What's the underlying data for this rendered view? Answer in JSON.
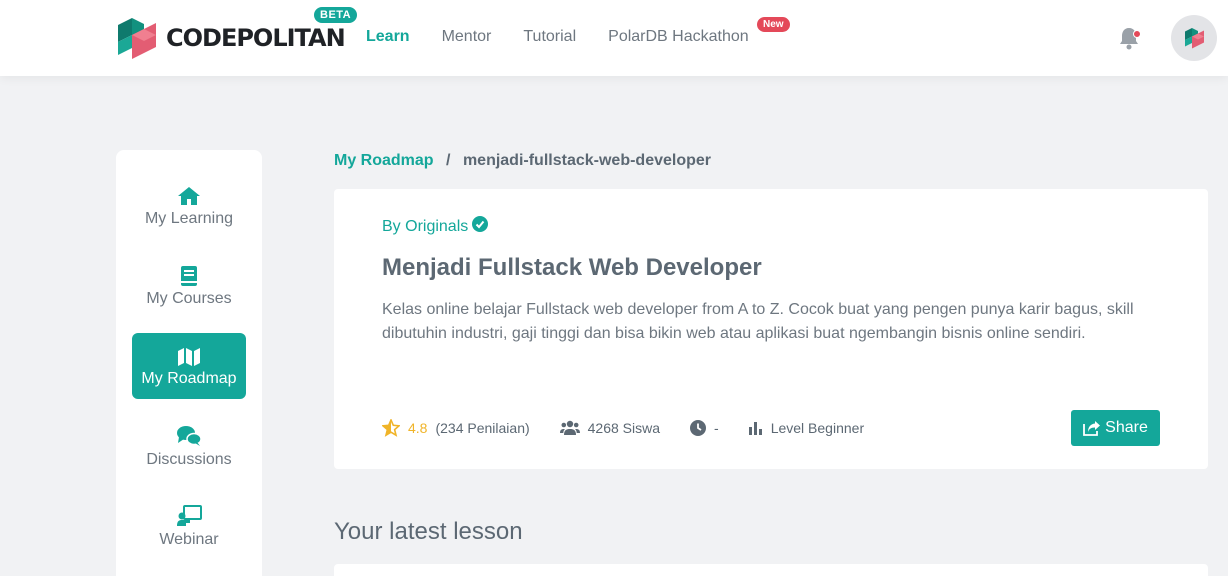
{
  "header": {
    "logo_text": "CODEPOLITAN",
    "beta_badge": "BETA",
    "nav": [
      "Learn",
      "Mentor",
      "Tutorial",
      "PolarDB Hackathon"
    ],
    "new_badge": "New"
  },
  "sidebar": {
    "items": [
      {
        "label": "My Learning",
        "icon": "home-icon"
      },
      {
        "label": "My Courses",
        "icon": "book-icon"
      },
      {
        "label": "My Roadmap",
        "icon": "map-icon"
      },
      {
        "label": "Discussions",
        "icon": "comments-icon"
      },
      {
        "label": "Webinar",
        "icon": "presentation-icon"
      }
    ],
    "active": "My Roadmap"
  },
  "breadcrumb": {
    "link": "My Roadmap",
    "separator": "/",
    "current": "menjadi-fullstack-web-developer"
  },
  "course": {
    "by": "By Originals",
    "title": "Menjadi Fullstack Web Developer",
    "description": "Kelas online belajar Fullstack web developer from A to Z. Cocok buat yang pengen punya karir bagus, skill dibutuhin industri, gaji tinggi dan bisa bikin web atau aplikasi buat ngembangin bisnis online sendiri.",
    "rating": "4.8",
    "reviews": "(234 Penilaian)",
    "students": "4268 Siswa",
    "duration": "-",
    "level": "Level Beginner",
    "share_label": "Share"
  },
  "latest": {
    "title": "Your latest lesson"
  },
  "colors": {
    "accent": "#14a79a",
    "badge_red": "#e44959",
    "star": "#f0b429",
    "logo_pink": "#e35d73",
    "logo_green": "#0f7a6d"
  }
}
